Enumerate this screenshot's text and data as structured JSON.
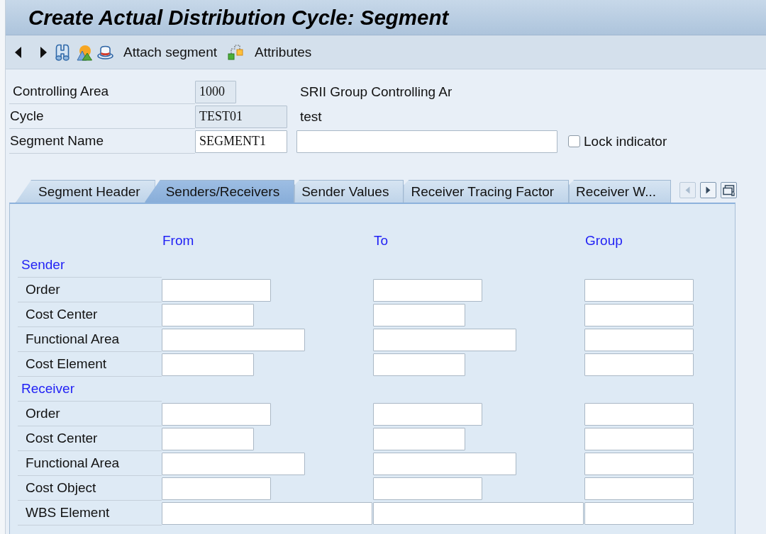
{
  "window": {
    "title": "Create Actual Distribution Cycle: Segment"
  },
  "toolbar": {
    "buttons": [
      {
        "kind": "text",
        "label": "Attach segment"
      },
      {
        "kind": "icon-text",
        "label": "Attributes"
      }
    ]
  },
  "header": {
    "controlling_area": {
      "label": "Controlling Area",
      "value": "1000",
      "editable": false,
      "description": "SRII Group Controlling Ar"
    },
    "cycle": {
      "label": "Cycle",
      "value": "TEST01",
      "editable": false,
      "description": "test"
    },
    "segment_name": {
      "label": "Segment Name",
      "value": "SEGMENT1",
      "editable": true
    },
    "lock_indicator": {
      "label": "Lock indicator",
      "checked": false
    }
  },
  "tabs": [
    {
      "label": "Segment Header",
      "selected": false
    },
    {
      "label": "Senders/Receivers",
      "selected": true
    },
    {
      "label": "Sender Values",
      "selected": false
    },
    {
      "label": "Receiver Tracing Factor",
      "selected": false
    },
    {
      "label": "Receiver W...",
      "selected": false
    }
  ],
  "tab_nav": {
    "previous_disabled": true,
    "next_disabled": false
  },
  "senders_receivers": {
    "columns": [
      "From",
      "To",
      "Group"
    ],
    "groups": [
      {
        "title": "Sender",
        "rows": [
          {
            "label": "Order",
            "kind": "medium"
          },
          {
            "label": "Cost Center",
            "kind": "short"
          },
          {
            "label": "Functional Area",
            "kind": "long"
          },
          {
            "label": "Cost Element",
            "kind": "short"
          }
        ]
      },
      {
        "title": "Receiver",
        "rows": [
          {
            "label": "Order",
            "kind": "medium"
          },
          {
            "label": "Cost Center",
            "kind": "short"
          },
          {
            "label": "Functional Area",
            "kind": "long"
          },
          {
            "label": "Cost Object",
            "kind": "medium"
          },
          {
            "label": "WBS Element",
            "kind": "wide"
          }
        ]
      }
    ]
  }
}
